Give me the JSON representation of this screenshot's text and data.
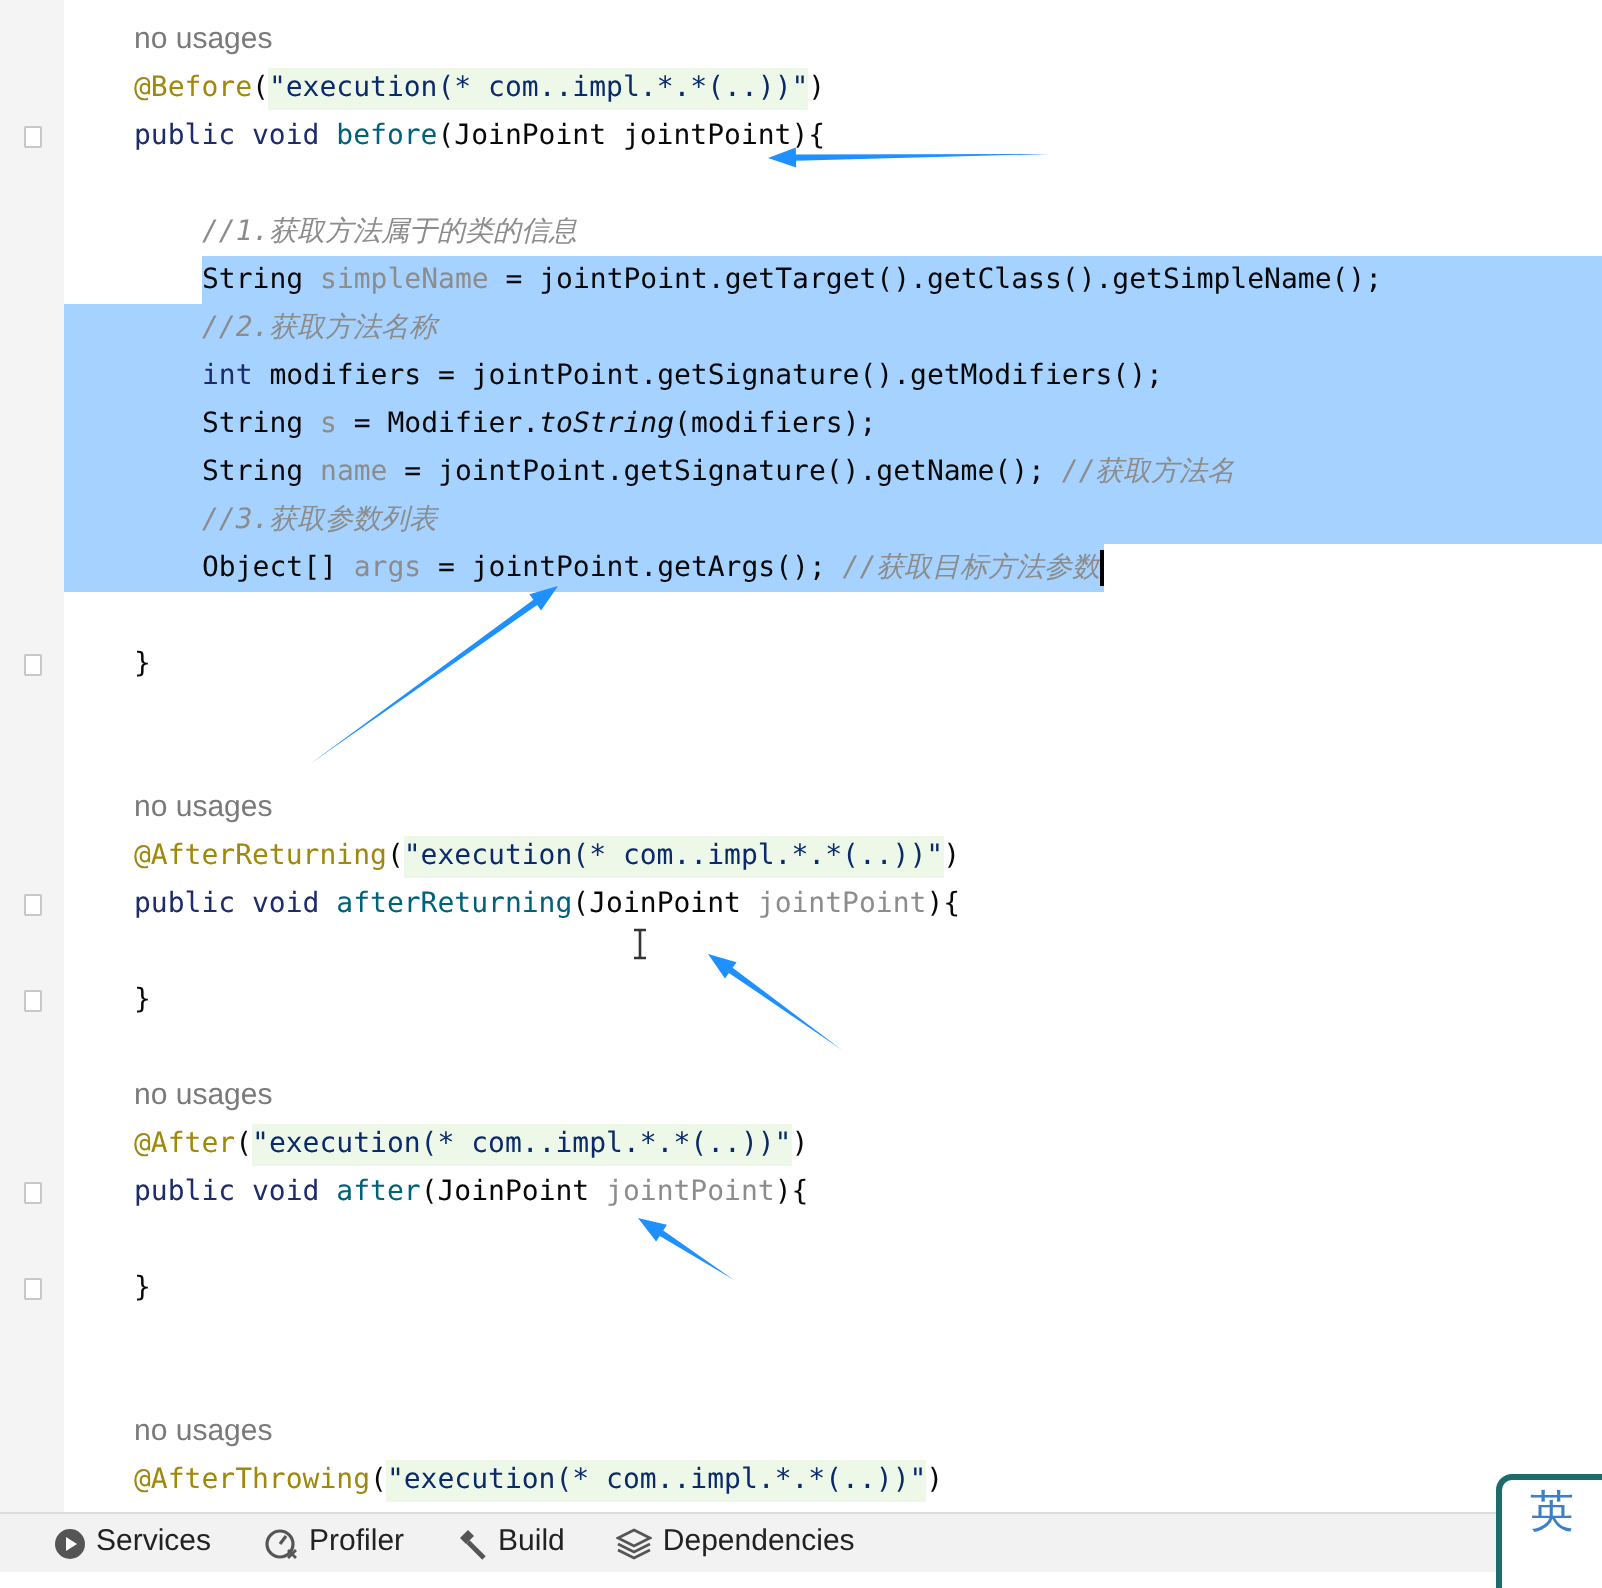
{
  "editor": {
    "lines": [
      {
        "kind": "hint",
        "fold": false,
        "selected": false,
        "text": "no usages"
      },
      {
        "kind": "code",
        "fold": false,
        "selected": false,
        "indented": false,
        "tokens": [
          {
            "text": "@Before",
            "kind": "annotation"
          },
          {
            "text": "(",
            "kind": "plain"
          },
          {
            "text": "\"execution(* com..impl.*.*(..))\"",
            "kind": "string"
          },
          {
            "text": ")",
            "kind": "plain"
          }
        ]
      },
      {
        "kind": "code",
        "fold": true,
        "selected": false,
        "indented": false,
        "tokens": [
          {
            "text": "public void ",
            "kind": "keyword"
          },
          {
            "text": "before",
            "kind": "method"
          },
          {
            "text": "(JoinPoint jointPoint){",
            "kind": "plain"
          }
        ]
      },
      {
        "kind": "blank",
        "fold": false,
        "selected": false
      },
      {
        "kind": "code",
        "fold": false,
        "selected": false,
        "indented": true,
        "tokens": [
          {
            "text": "//1.获取方法属于的类的信息",
            "kind": "comment"
          }
        ]
      },
      {
        "kind": "code",
        "fold": false,
        "selected": true,
        "indented": true,
        "tokens": [
          {
            "text": "String ",
            "kind": "plain"
          },
          {
            "text": "simpleName",
            "kind": "unused"
          },
          {
            "text": " = jointPoint.getTarget().getClass().getSimpleName();",
            "kind": "plain"
          }
        ]
      },
      {
        "kind": "code",
        "fold": false,
        "selected": true,
        "indented": true,
        "tokens": [
          {
            "text": "//2.获取方法名称",
            "kind": "comment"
          }
        ]
      },
      {
        "kind": "code",
        "fold": false,
        "selected": true,
        "indented": true,
        "tokens": [
          {
            "text": "int ",
            "kind": "keyword"
          },
          {
            "text": "modifiers = jointPoint.getSignature().getModifiers();",
            "kind": "plain"
          }
        ]
      },
      {
        "kind": "code",
        "fold": false,
        "selected": true,
        "indented": true,
        "tokens": [
          {
            "text": "String ",
            "kind": "plain"
          },
          {
            "text": "s",
            "kind": "unused"
          },
          {
            "text": " = Modifier.",
            "kind": "plain"
          },
          {
            "text": "toString",
            "kind": "static"
          },
          {
            "text": "(modifiers);",
            "kind": "plain"
          }
        ]
      },
      {
        "kind": "code",
        "fold": false,
        "selected": true,
        "indented": true,
        "tokens": [
          {
            "text": "String ",
            "kind": "plain"
          },
          {
            "text": "name",
            "kind": "unused"
          },
          {
            "text": " = jointPoint.getSignature().getName(); ",
            "kind": "plain"
          },
          {
            "text": "//获取方法名",
            "kind": "comment"
          }
        ]
      },
      {
        "kind": "code",
        "fold": false,
        "selected": true,
        "indented": true,
        "tokens": [
          {
            "text": "//3.获取参数列表",
            "kind": "comment"
          }
        ]
      },
      {
        "kind": "code",
        "fold": false,
        "selected": true,
        "indented": true,
        "tokens": [
          {
            "text": "Object[] ",
            "kind": "plain"
          },
          {
            "text": "args",
            "kind": "unused"
          },
          {
            "text": " = jointPoint.getArgs(); ",
            "kind": "plain"
          },
          {
            "text": "//获取目标方法参数",
            "kind": "comment"
          }
        ]
      },
      {
        "kind": "blank",
        "fold": false,
        "selected": false
      },
      {
        "kind": "code",
        "fold": true,
        "selected": false,
        "indented": false,
        "tokens": [
          {
            "text": "}",
            "kind": "plain"
          }
        ]
      },
      {
        "kind": "blank",
        "fold": false,
        "selected": false
      },
      {
        "kind": "blank",
        "fold": false,
        "selected": false
      },
      {
        "kind": "hint",
        "fold": false,
        "selected": false,
        "text": "no usages"
      },
      {
        "kind": "code",
        "fold": false,
        "selected": false,
        "indented": false,
        "tokens": [
          {
            "text": "@AfterReturning",
            "kind": "annotation"
          },
          {
            "text": "(",
            "kind": "plain"
          },
          {
            "text": "\"execution(* com..impl.*.*(..))\"",
            "kind": "string"
          },
          {
            "text": ")",
            "kind": "plain"
          }
        ]
      },
      {
        "kind": "code",
        "fold": true,
        "selected": false,
        "indented": false,
        "tokens": [
          {
            "text": "public void ",
            "kind": "keyword"
          },
          {
            "text": "afterReturning",
            "kind": "method"
          },
          {
            "text": "(JoinPoint ",
            "kind": "plain"
          },
          {
            "text": "jointPoint",
            "kind": "unused"
          },
          {
            "text": "){",
            "kind": "plain"
          }
        ]
      },
      {
        "kind": "blank",
        "fold": false,
        "selected": false
      },
      {
        "kind": "code",
        "fold": true,
        "selected": false,
        "indented": false,
        "tokens": [
          {
            "text": "}",
            "kind": "plain"
          }
        ]
      },
      {
        "kind": "blank",
        "fold": false,
        "selected": false
      },
      {
        "kind": "hint",
        "fold": false,
        "selected": false,
        "text": "no usages"
      },
      {
        "kind": "code",
        "fold": false,
        "selected": false,
        "indented": false,
        "tokens": [
          {
            "text": "@After",
            "kind": "annotation"
          },
          {
            "text": "(",
            "kind": "plain"
          },
          {
            "text": "\"execution(* com..impl.*.*(..))\"",
            "kind": "string"
          },
          {
            "text": ")",
            "kind": "plain"
          }
        ]
      },
      {
        "kind": "code",
        "fold": true,
        "selected": false,
        "indented": false,
        "tokens": [
          {
            "text": "public void ",
            "kind": "keyword"
          },
          {
            "text": "after",
            "kind": "method"
          },
          {
            "text": "(JoinPoint ",
            "kind": "plain"
          },
          {
            "text": "jointPoint",
            "kind": "unused"
          },
          {
            "text": "){",
            "kind": "plain"
          }
        ]
      },
      {
        "kind": "blank",
        "fold": false,
        "selected": false
      },
      {
        "kind": "code",
        "fold": true,
        "selected": false,
        "indented": false,
        "tokens": [
          {
            "text": "}",
            "kind": "plain"
          }
        ]
      },
      {
        "kind": "blank",
        "fold": false,
        "selected": false
      },
      {
        "kind": "blank",
        "fold": false,
        "selected": false
      },
      {
        "kind": "hint",
        "fold": false,
        "selected": false,
        "text": "no usages"
      },
      {
        "kind": "code",
        "fold": false,
        "selected": false,
        "indented": false,
        "tokens": [
          {
            "text": "@AfterThrowing",
            "kind": "annotation"
          },
          {
            "text": "(",
            "kind": "plain"
          },
          {
            "text": "\"execution(* com..impl.*.*(..))\"",
            "kind": "string"
          },
          {
            "text": ")",
            "kind": "plain"
          }
        ]
      }
    ]
  },
  "tool_windows": [
    {
      "label": "Services",
      "kind": "services"
    },
    {
      "label": "Profiler",
      "kind": "profiler"
    },
    {
      "label": "Build",
      "kind": "build"
    },
    {
      "label": "Dependencies",
      "kind": "dependencies"
    }
  ],
  "ime": {
    "label": "英"
  }
}
